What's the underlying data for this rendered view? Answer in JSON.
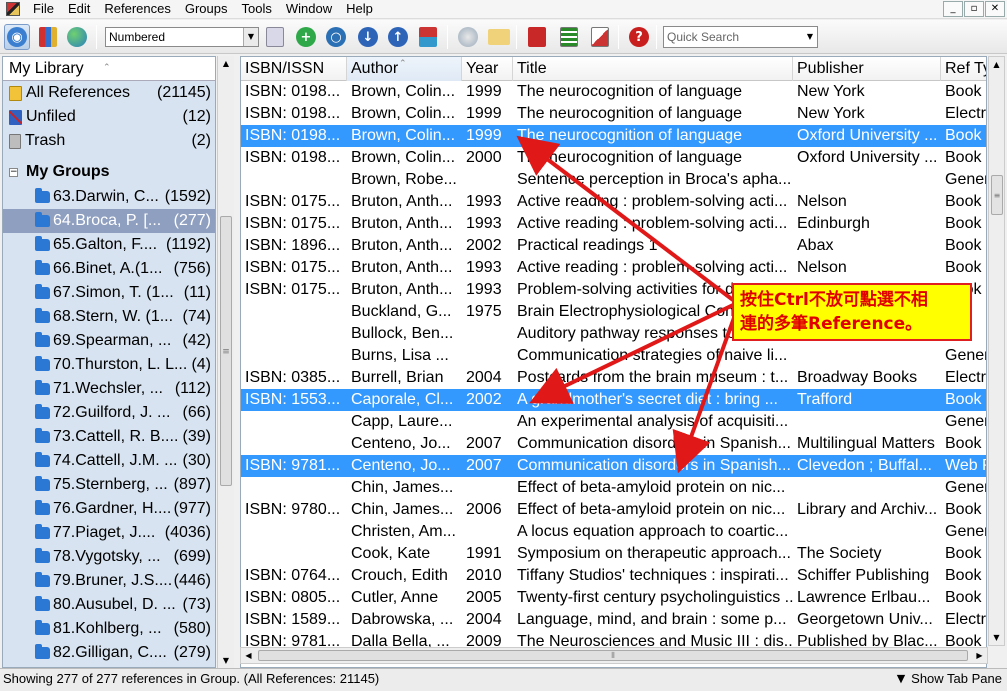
{
  "menubar": {
    "items": [
      "File",
      "Edit",
      "References",
      "Groups",
      "Tools",
      "Window",
      "Help"
    ],
    "window_controls": [
      "_",
      "▫",
      "✕"
    ]
  },
  "toolbar": {
    "style_select": "Numbered",
    "quick_search_placeholder": "Quick Search",
    "buttons": [
      {
        "icon": "local-library-icon"
      },
      {
        "icon": "online-library-icon"
      },
      {
        "icon": "globe-icon"
      },
      {
        "icon": "copy-formatted-icon"
      },
      {
        "icon": "new-reference-icon"
      },
      {
        "icon": "online-search-icon"
      },
      {
        "icon": "import-icon"
      },
      {
        "icon": "export-icon"
      },
      {
        "icon": "find-full-text-icon"
      },
      {
        "icon": "open-link-icon"
      },
      {
        "icon": "open-file-icon"
      },
      {
        "icon": "go-to-word-icon"
      },
      {
        "icon": "format-paper-icon"
      },
      {
        "icon": "insert-citation-icon"
      },
      {
        "icon": "help-icon"
      }
    ]
  },
  "library": {
    "header": "My Library",
    "items": [
      {
        "label": "All References",
        "count": "(21145)",
        "icon": "all-references-icon"
      },
      {
        "label": "Unfiled",
        "count": "(12)",
        "icon": "unfiled-icon"
      },
      {
        "label": "Trash",
        "count": "(2)",
        "icon": "trash-icon"
      }
    ],
    "groups_header": "My Groups",
    "groups": [
      {
        "label": "63.Darwin, C...",
        "count": "(1592)"
      },
      {
        "label": "64.Broca, P. [...",
        "count": "(277)",
        "selected": true
      },
      {
        "label": "65.Galton, F....",
        "count": "(1192)"
      },
      {
        "label": "66.Binet, A.(1...",
        "count": "(756)"
      },
      {
        "label": "67.Simon, T. (1...",
        "count": "(11)"
      },
      {
        "label": "68.Stern, W. (1...",
        "count": "(74)"
      },
      {
        "label": "69.Spearman, ...",
        "count": "(42)"
      },
      {
        "label": "70.Thurston, L. L...",
        "count": "(4)"
      },
      {
        "label": "71.Wechsler, ...",
        "count": "(112)"
      },
      {
        "label": "72.Guilford, J. ...",
        "count": "(66)"
      },
      {
        "label": "73.Cattell, R. B....",
        "count": "(39)"
      },
      {
        "label": "74.Cattell, J.M. ...",
        "count": "(30)"
      },
      {
        "label": "75.Sternberg, ...",
        "count": "(897)"
      },
      {
        "label": "76.Gardner, H....",
        "count": "(977)"
      },
      {
        "label": "77.Piaget, J....",
        "count": "(4036)"
      },
      {
        "label": "78.Vygotsky, ...",
        "count": "(699)"
      },
      {
        "label": "79.Bruner, J.S....",
        "count": "(446)"
      },
      {
        "label": "80.Ausubel, D. ...",
        "count": "(73)"
      },
      {
        "label": "81.Kohlberg, ...",
        "count": "(580)"
      },
      {
        "label": "82.Gilligan, C....",
        "count": "(279)"
      }
    ]
  },
  "table": {
    "columns": [
      "ISBN/ISSN",
      "Author",
      "Year",
      "Title",
      "Publisher",
      "Ref Ty"
    ],
    "rows": [
      {
        "isbn": "ISBN: 0198...",
        "author": "Brown, Colin...",
        "year": "1999",
        "title": "The neurocognition of language",
        "publisher": "New York",
        "ref": "Book"
      },
      {
        "isbn": "ISBN: 0198...",
        "author": "Brown, Colin...",
        "year": "1999",
        "title": "The neurocognition of language",
        "publisher": "New York",
        "ref": "Electro"
      },
      {
        "isbn": "ISBN: 0198...",
        "author": "Brown, Colin...",
        "year": "1999",
        "title": "The neurocognition of language",
        "publisher": "Oxford University ...",
        "ref": "Book",
        "selected": true
      },
      {
        "isbn": "ISBN: 0198...",
        "author": "Brown, Colin...",
        "year": "2000",
        "title": "The neurocognition of language",
        "publisher": "Oxford University ...",
        "ref": "Book"
      },
      {
        "isbn": "",
        "author": "Brown, Robe...",
        "year": "",
        "title": "Sentence perception in Broca's apha...",
        "publisher": "",
        "ref": "Gener"
      },
      {
        "isbn": "ISBN: 0175...",
        "author": "Bruton, Anth...",
        "year": "1993",
        "title": "Active reading : problem-solving acti...",
        "publisher": "Nelson",
        "ref": "Book"
      },
      {
        "isbn": "ISBN: 0175...",
        "author": "Bruton, Anth...",
        "year": "1993",
        "title": "Active reading : problem-solving acti...",
        "publisher": "Edinburgh",
        "ref": "Book"
      },
      {
        "isbn": "ISBN: 1896...",
        "author": "Bruton, Anth...",
        "year": "2002",
        "title": "Practical readings 1",
        "publisher": "Abax",
        "ref": "Book"
      },
      {
        "isbn": "ISBN: 0175...",
        "author": "Bruton, Anth...",
        "year": "1993",
        "title": "Active reading : problem-solving acti...",
        "publisher": "Nelson",
        "ref": "Book"
      },
      {
        "isbn": "ISBN: 0175...",
        "author": "Bruton, Anth...",
        "year": "1993",
        "title": "Problem-solving activities for de...",
        "publisher": "",
        "ref": "Book"
      },
      {
        "isbn": "",
        "author": "Buckland, G...",
        "year": "1975",
        "title": "Brain Electrophysiological Cond...",
        "publisher": "",
        "ref": ""
      },
      {
        "isbn": "",
        "author": "Bullock, Ben...",
        "year": "",
        "title": "Auditory pathway responses to...",
        "publisher": "",
        "ref": ""
      },
      {
        "isbn": "",
        "author": "Burns, Lisa ...",
        "year": "",
        "title": "Communication strategies of naive li...",
        "publisher": "",
        "ref": "Gener"
      },
      {
        "isbn": "ISBN: 0385...",
        "author": "Burrell, Brian",
        "year": "2004",
        "title": "Postcards from the brain museum : t...",
        "publisher": "Broadway Books",
        "ref": "Electro"
      },
      {
        "isbn": "ISBN: 1553...",
        "author": "Caporale, Cl...",
        "year": "2002",
        "title": "A grandmother's secret diet : bring ...",
        "publisher": "Trafford",
        "ref": "Book",
        "selected": true
      },
      {
        "isbn": "",
        "author": "Capp, Laure...",
        "year": "",
        "title": "An experimental analysis of acquisiti...",
        "publisher": "",
        "ref": "Gener"
      },
      {
        "isbn": "",
        "author": "Centeno, Jo...",
        "year": "2007",
        "title": "Communication disorders in Spanish...",
        "publisher": "Multilingual Matters",
        "ref": "Book"
      },
      {
        "isbn": "ISBN: 9781...",
        "author": "Centeno, Jo...",
        "year": "2007",
        "title": "Communication disorders in Spanish...",
        "publisher": "Clevedon ; Buffal...",
        "ref": "Web P",
        "selected": true
      },
      {
        "isbn": "",
        "author": "Chin, James...",
        "year": "",
        "title": "Effect of beta-amyloid protein on nic...",
        "publisher": "",
        "ref": "Gener"
      },
      {
        "isbn": "ISBN: 9780...",
        "author": "Chin, James...",
        "year": "2006",
        "title": "Effect of beta-amyloid protein on nic...",
        "publisher": "Library and Archiv...",
        "ref": "Book"
      },
      {
        "isbn": "",
        "author": "Christen, Am...",
        "year": "",
        "title": "A locus equation approach to coartic...",
        "publisher": "",
        "ref": "Gener"
      },
      {
        "isbn": "",
        "author": "Cook, Kate",
        "year": "1991",
        "title": "Symposium on therapeutic approach...",
        "publisher": "The Society",
        "ref": "Book"
      },
      {
        "isbn": "ISBN: 0764...",
        "author": "Crouch, Edith",
        "year": "2010",
        "title": "Tiffany Studios' techniques : inspirati...",
        "publisher": "Schiffer Publishing",
        "ref": "Book"
      },
      {
        "isbn": "ISBN: 0805...",
        "author": "Cutler, Anne",
        "year": "2005",
        "title": "Twenty-first century psycholinguistics ...",
        "publisher": "Lawrence Erlbau...",
        "ref": "Book"
      },
      {
        "isbn": "ISBN: 1589...",
        "author": "Dabrowska, ...",
        "year": "2004",
        "title": "Language, mind, and brain : some p...",
        "publisher": "Georgetown Univ...",
        "ref": "Electro"
      },
      {
        "isbn": "ISBN: 9781...",
        "author": "Dalla Bella, ...",
        "year": "2009",
        "title": "The Neurosciences and Music III : dis...",
        "publisher": "Published by Blac...",
        "ref": "Book"
      }
    ]
  },
  "annotation": {
    "line1": "按住Ctrl不放可點選不相",
    "line2": "連的多筆Reference。"
  },
  "statusbar": {
    "text": "Showing 277 of 277 references in Group. (All References: 21145)",
    "show_tab": "Show Tab Pane"
  },
  "colors": {
    "selection": "#3399ff",
    "group_selected": "#8e9fc0",
    "annotation_bg": "#ffff00",
    "annotation_text": "#e00000",
    "arrow": "#e01818"
  }
}
